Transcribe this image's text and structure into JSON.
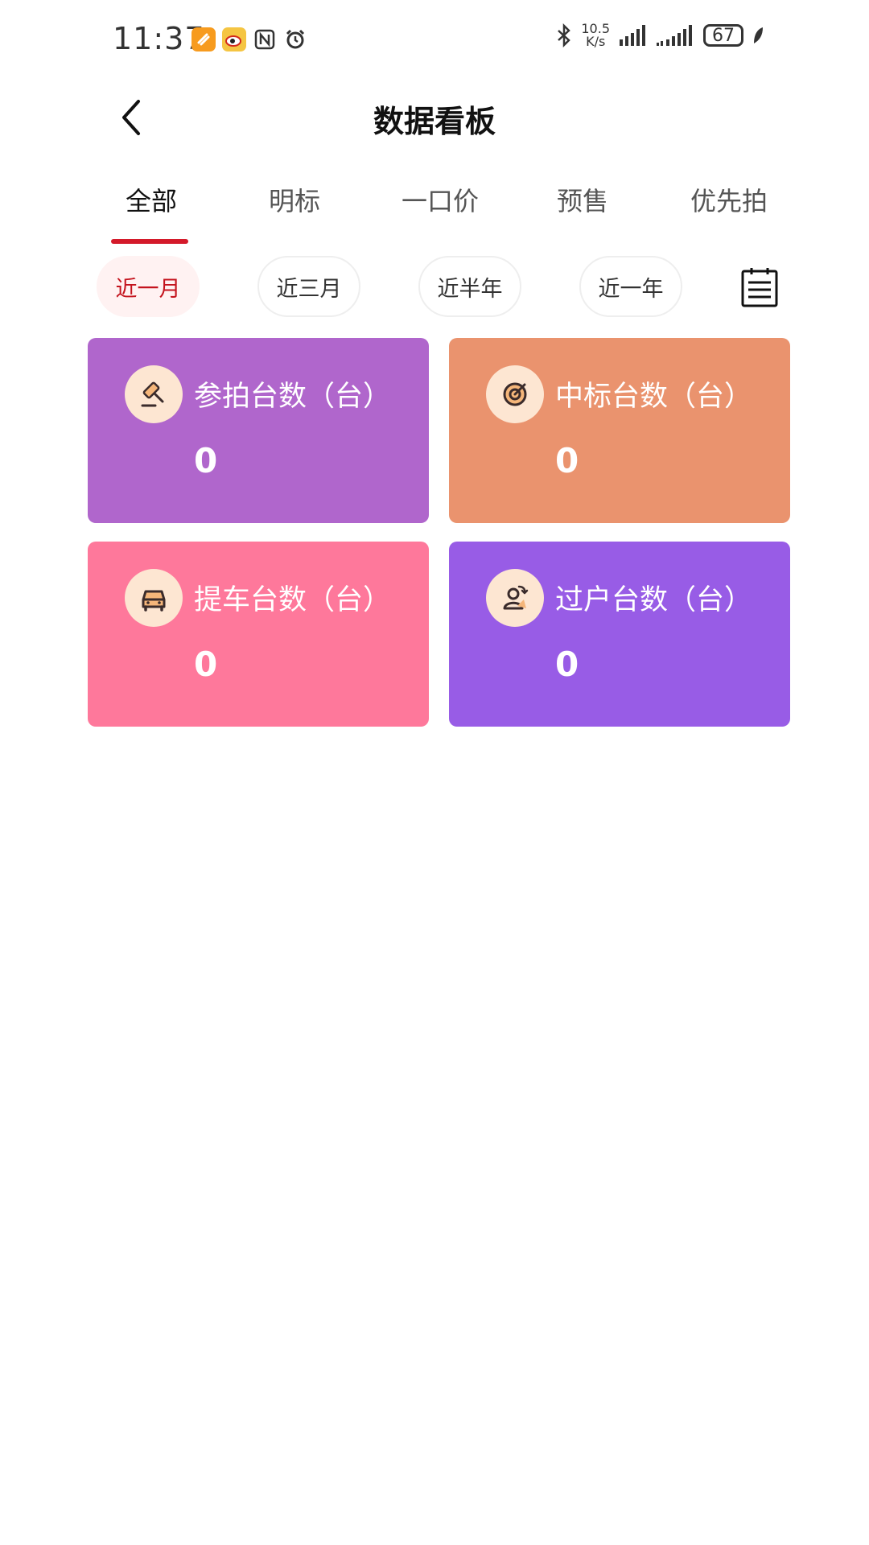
{
  "status_bar": {
    "time": "11:37",
    "net_speed_value": "10.5",
    "net_speed_unit": "K/s",
    "battery": "67"
  },
  "header": {
    "title": "数据看板"
  },
  "tabs": [
    {
      "label": "全部",
      "active": true
    },
    {
      "label": "明标",
      "active": false
    },
    {
      "label": "一口价",
      "active": false
    },
    {
      "label": "预售",
      "active": false
    },
    {
      "label": "优先拍",
      "active": false
    }
  ],
  "periods": [
    {
      "label": "近一月",
      "active": true
    },
    {
      "label": "近三月",
      "active": false
    },
    {
      "label": "近半年",
      "active": false
    },
    {
      "label": "近一年",
      "active": false
    }
  ],
  "cards": [
    {
      "title": "参拍台数（台）",
      "value": "0",
      "color": "#b066cc",
      "icon": "gavel-icon"
    },
    {
      "title": "中标台数（台）",
      "value": "0",
      "color": "#ea936e",
      "icon": "target-icon"
    },
    {
      "title": "提车台数（台）",
      "value": "0",
      "color": "#fe789b",
      "icon": "car-icon"
    },
    {
      "title": "过户台数（台）",
      "value": "0",
      "color": "#985ce6",
      "icon": "transfer-user-icon"
    }
  ],
  "colors": {
    "accent": "#d41a2a",
    "chip_active_bg": "#fff2f2",
    "chip_active_text": "#c4141e"
  }
}
